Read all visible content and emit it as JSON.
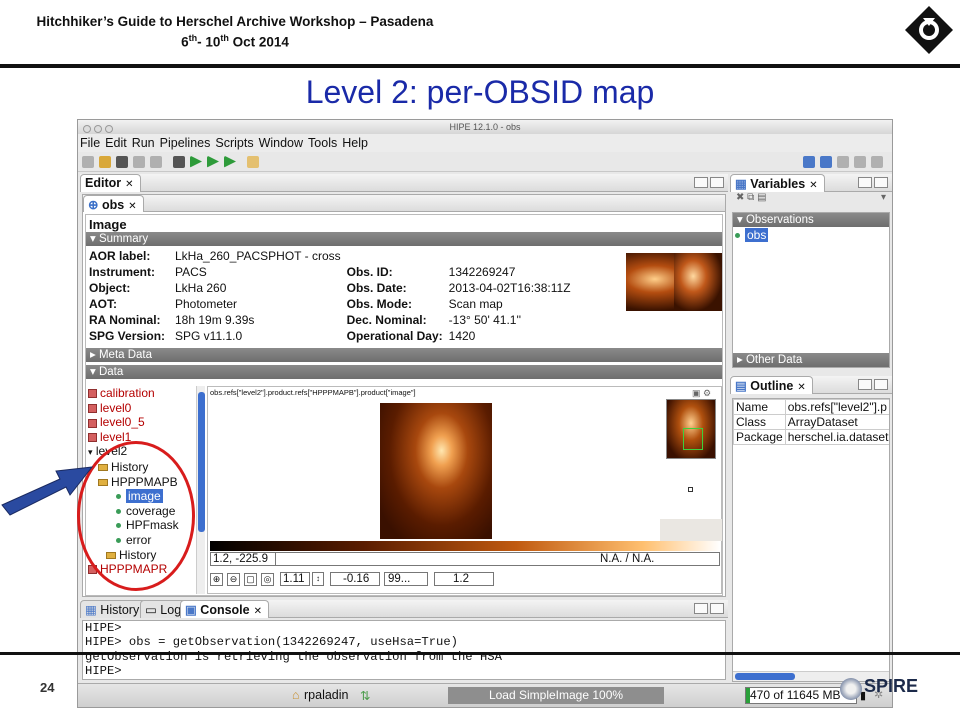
{
  "slide": {
    "header_line1": "Hitchhiker’s Guide to Herschel Archive Workshop – Pasadena",
    "header_line2_a": "6",
    "header_line2_sup_a": "th",
    "header_line2_b": "- 10",
    "header_line2_sup_b": "th",
    "header_line2_c": " Oct 2014",
    "title": "Level 2: per-OBSID map",
    "page_number": "24",
    "footer_logo_text": "SPIRE",
    "logo_text": "HERSCHEL"
  },
  "window": {
    "title": "HIPE 12.1.0 - obs",
    "menu": [
      "File",
      "Edit",
      "Run",
      "Pipelines",
      "Scripts",
      "Window",
      "Tools",
      "Help"
    ]
  },
  "editor": {
    "tab_label": "Editor",
    "subtab_label": "obs",
    "heading": "Image",
    "summary_label": "Summary",
    "summary": [
      {
        "k1": "AOR label:",
        "v1": "LkHa_260_PACSPHOT  - cross",
        "k2": "",
        "v2": ""
      },
      {
        "k1": "Instrument:",
        "v1": "PACS",
        "k2": "Obs. ID:",
        "v2": "1342269247"
      },
      {
        "k1": "Object:",
        "v1": "LkHa 260",
        "k2": "Obs. Date:",
        "v2": "2013-04-02T16:38:11Z"
      },
      {
        "k1": "AOT:",
        "v1": "Photometer",
        "k2": "Obs. Mode:",
        "v2": "Scan map"
      },
      {
        "k1": "RA Nominal:",
        "v1": "18h 19m 9.39s",
        "k2": "Dec. Nominal:",
        "v2": "-13° 50' 41.1''"
      },
      {
        "k1": "SPG Version:",
        "v1": "SPG v11.1.0",
        "k2": "Operational Day:",
        "v2": "1420"
      }
    ],
    "meta_label": "Meta Data",
    "data_label": "Data",
    "tree": {
      "calibration": "calibration",
      "level0": "level0",
      "level0_5": "level0_5",
      "level1": "level1",
      "level2": "level2",
      "history": "History",
      "hpppmapb": "HPPPMAPB",
      "image": "image",
      "coverage": "coverage",
      "hpfmask": "HPFmask",
      "error": "error",
      "history2": "History",
      "hpppmapr": "HPPPMAPR"
    },
    "image_path": "obs.refs[\"level2\"].product.refs[\"HPPPMAPB\"].product[\"image\"]",
    "colorbar_range": "1.2, -225.9",
    "pixel_value": "N.A. / N.A.",
    "controls": {
      "zoom": "1.11",
      "min": "-0.16",
      "percent": "99...",
      "max": "1.2"
    }
  },
  "variables": {
    "tab_label": "Variables",
    "observations_label": "Observations",
    "item": "obs",
    "other_label": "Other Data"
  },
  "outline": {
    "tab_label": "Outline",
    "rows": [
      {
        "k": "Name",
        "v": "obs.refs[\"level2\"].p"
      },
      {
        "k": "Class",
        "v": "ArrayDataset"
      },
      {
        "k": "Package",
        "v": "herschel.ia.dataset"
      }
    ]
  },
  "console": {
    "tabs": [
      "History",
      "Log",
      "Console"
    ],
    "lines": [
      "HIPE>",
      "HIPE> obs = getObservation(1342269247, useHsa=True)",
      "getObservation is retrieving the observation from the HSA",
      "HIPE>"
    ]
  },
  "status": {
    "user": "rpaladin",
    "progress_text": "Load SimpleImage 100%",
    "memory_text": "470 of 11645 MB",
    "memory_fraction": 0.04
  },
  "colors": {
    "title_blue": "#1a2aa8",
    "selection": "#3d6fcf",
    "annotation_red": "#d81c1c",
    "arrow_blue": "#2a4aa0"
  }
}
